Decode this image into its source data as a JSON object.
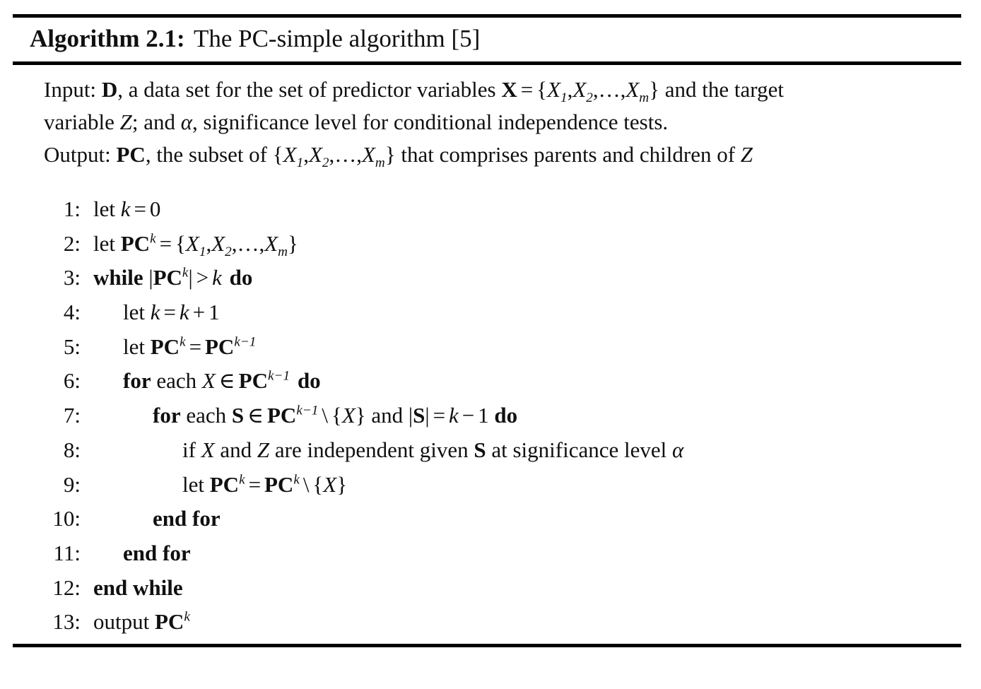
{
  "caption": {
    "label": "Algorithm 2.1:",
    "title": "The PC-simple algorithm [5]",
    "full": "Algorithm 2.1: The PC-simple algorithm [5]"
  },
  "io": {
    "input_line1": "Input: D, a data set for the set of predictor variables X = {X1,X2,…,Xm} and the target",
    "input_line2": "variable Z; and α, significance level for conditional independence tests.",
    "output_line": "Output: PC, the subset of {X1,X2,…,Xm} that comprises parents and children of Z",
    "input_label": "Input:",
    "output_label": "Output:"
  },
  "steps": [
    {
      "num": "1:",
      "indent": 0,
      "text": "let k = 0"
    },
    {
      "num": "2:",
      "indent": 0,
      "text": "let PC^k = {X1,X2,…,Xm}"
    },
    {
      "num": "3:",
      "indent": 0,
      "text": "while |PC^k| > k do"
    },
    {
      "num": "4:",
      "indent": 1,
      "text": "let k = k + 1"
    },
    {
      "num": "5:",
      "indent": 1,
      "text": "let PC^k = PC^{k-1}"
    },
    {
      "num": "6:",
      "indent": 1,
      "text": "for each X ∈ PC^{k-1} do"
    },
    {
      "num": "7:",
      "indent": 2,
      "text": "for each S ∈ PC^{k-1} \\ {X} and |S| = k - 1 do"
    },
    {
      "num": "8:",
      "indent": 3,
      "text": "if X and Z are independent given S at significance level α"
    },
    {
      "num": "9:",
      "indent": 3,
      "text": "let PC^k = PC^k \\ {X}"
    },
    {
      "num": "10:",
      "indent": 2,
      "text": "end for"
    },
    {
      "num": "11:",
      "indent": 1,
      "text": "end for"
    },
    {
      "num": "12:",
      "indent": 0,
      "text": "end while"
    },
    {
      "num": "13:",
      "indent": 0,
      "text": "output PC^k"
    }
  ],
  "colors": {
    "rule": "#000000",
    "text": "#101010",
    "background": "#ffffff"
  }
}
